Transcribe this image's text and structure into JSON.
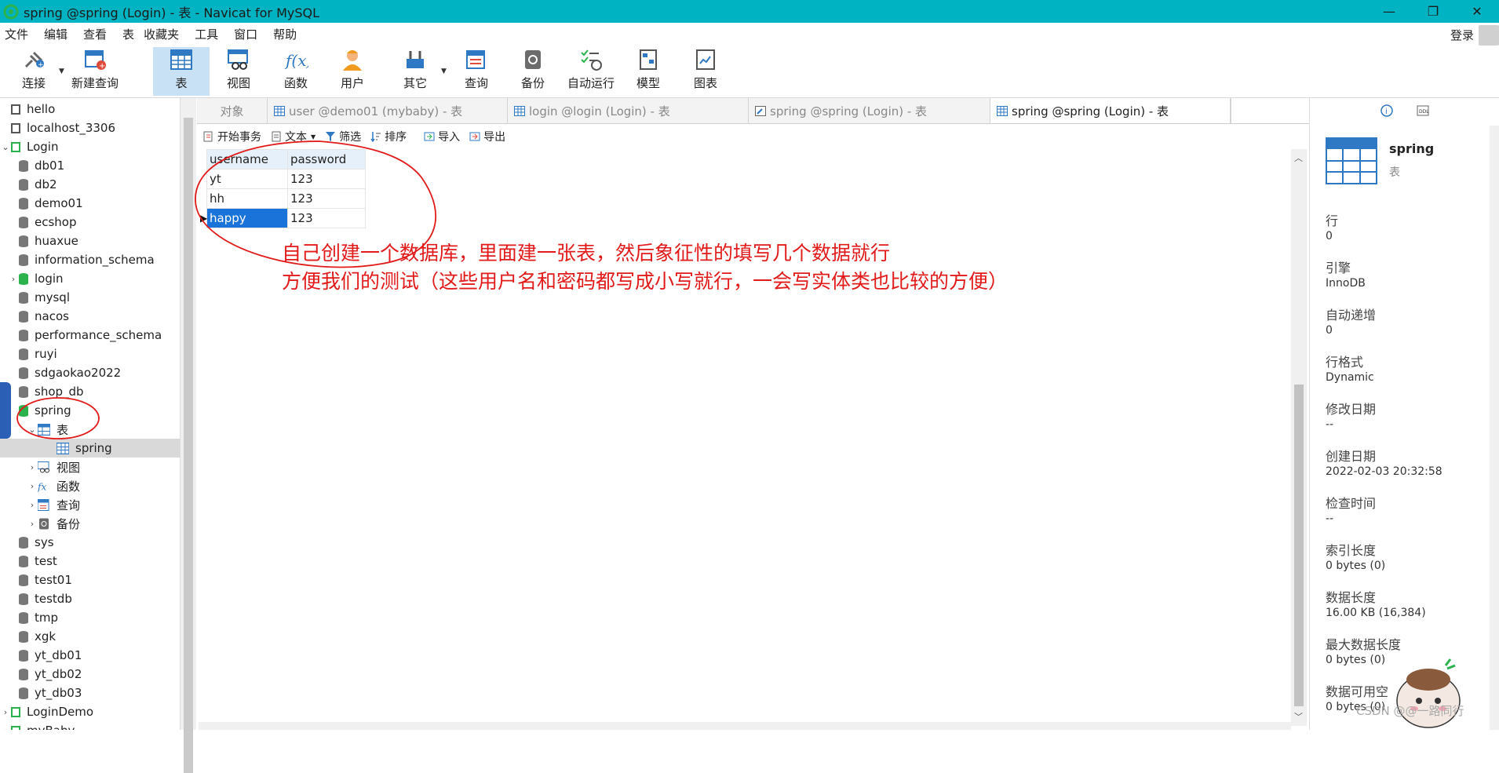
{
  "window": {
    "title": "spring @spring (Login) - 表 - Navicat for MySQL"
  },
  "menu": {
    "items": [
      "文件",
      "编辑",
      "查看",
      "表",
      "收藏夹",
      "工具",
      "窗口",
      "帮助"
    ],
    "login": "登录"
  },
  "toolbar": {
    "connect": "连接",
    "new_query": "新建查询",
    "table": "表",
    "view": "视图",
    "function": "函数",
    "user": "用户",
    "other": "其它",
    "query": "查询",
    "backup": "备份",
    "auto_run": "自动运行",
    "model": "模型",
    "chart": "图表"
  },
  "sidebar": {
    "items": [
      {
        "label": "hello"
      },
      {
        "label": "localhost_3306"
      },
      {
        "label": "Login"
      },
      {
        "label": "db01"
      },
      {
        "label": "db2"
      },
      {
        "label": "demo01"
      },
      {
        "label": "ecshop"
      },
      {
        "label": "huaxue"
      },
      {
        "label": "information_schema"
      },
      {
        "label": "login"
      },
      {
        "label": "mysql"
      },
      {
        "label": "nacos"
      },
      {
        "label": "performance_schema"
      },
      {
        "label": "ruyi"
      },
      {
        "label": "sdgaokao2022"
      },
      {
        "label": "shop_db"
      },
      {
        "label": "spring"
      },
      {
        "label": "表"
      },
      {
        "label": "spring"
      },
      {
        "label": "视图"
      },
      {
        "label": "函数"
      },
      {
        "label": "查询"
      },
      {
        "label": "备份"
      },
      {
        "label": "sys"
      },
      {
        "label": "test"
      },
      {
        "label": "test01"
      },
      {
        "label": "testdb"
      },
      {
        "label": "tmp"
      },
      {
        "label": "xgk"
      },
      {
        "label": "yt_db01"
      },
      {
        "label": "yt_db02"
      },
      {
        "label": "yt_db03"
      },
      {
        "label": "LoginDemo"
      },
      {
        "label": "myBaby"
      }
    ]
  },
  "tabs": [
    {
      "label": "对象"
    },
    {
      "label": "user @demo01 (mybaby) - 表"
    },
    {
      "label": "login @login (Login) - 表"
    },
    {
      "label": "spring @spring (Login) - 表"
    },
    {
      "label": "spring @spring (Login) - 表"
    }
  ],
  "subtoolbar": {
    "begin_transaction": "开始事务",
    "text": "文本",
    "filter": "筛选",
    "sort": "排序",
    "import": "导入",
    "export": "导出"
  },
  "grid": {
    "columns": [
      "username",
      "password"
    ],
    "rows": [
      [
        "yt",
        "123"
      ],
      [
        "hh",
        "123"
      ],
      [
        "happy",
        "123"
      ]
    ]
  },
  "annotation": {
    "line1": "自己创建一个数据库，里面建一张表，然后象征性的填写几个数据就行",
    "line2": "方便我们的测试（这些用户名和密码都写成小写就行，一会写实体类也比较的方便）",
    "color": "#e21a1a"
  },
  "info_panel": {
    "name": "spring",
    "type": "表",
    "fields": [
      {
        "label": "行",
        "value": "0"
      },
      {
        "label": "引擎",
        "value": "InnoDB"
      },
      {
        "label": "自动递增",
        "value": "0"
      },
      {
        "label": "行格式",
        "value": "Dynamic"
      },
      {
        "label": "修改日期",
        "value": "--"
      },
      {
        "label": "创建日期",
        "value": "2022-02-03 20:32:58"
      },
      {
        "label": "检查时间",
        "value": "--"
      },
      {
        "label": "索引长度",
        "value": "0 bytes (0)"
      },
      {
        "label": "数据长度",
        "value": "16.00 KB (16,384)"
      },
      {
        "label": "最大数据长度",
        "value": "0 bytes (0)"
      },
      {
        "label": "数据可用空",
        "value": "0 bytes (0)"
      }
    ]
  },
  "watermark": "CSDN @@一路同行",
  "colors": {
    "titlebar": "#00b3c2",
    "selection": "#1a73d9",
    "annotation": "#e21a1a"
  }
}
